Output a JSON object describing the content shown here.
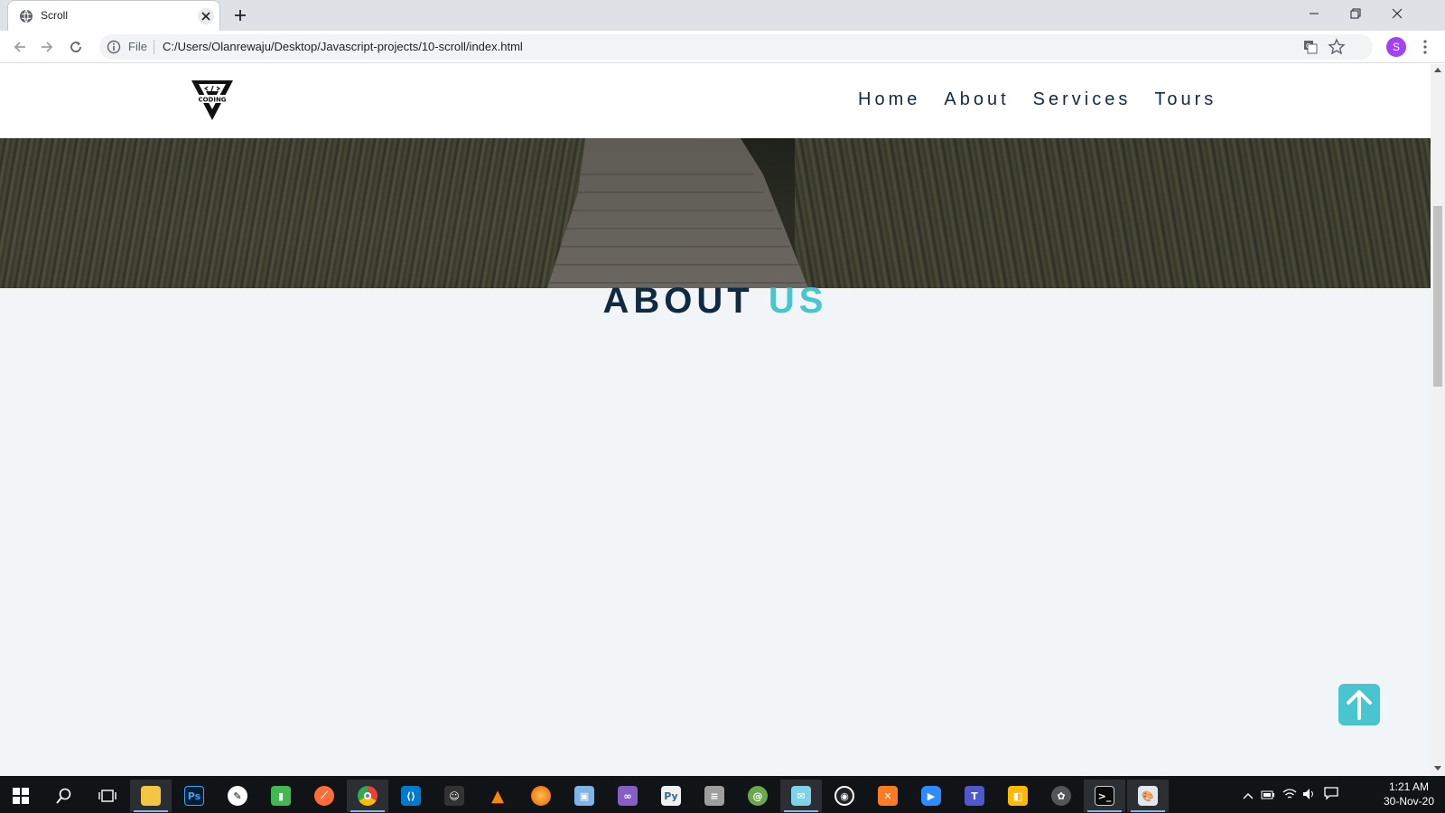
{
  "browser": {
    "tab_title": "Scroll",
    "url_scheme_label": "File",
    "url": "C:/Users/Olanrewaju/Desktop/Javascript-projects/10-scroll/index.html",
    "profile_initial": "S"
  },
  "page": {
    "logo_text": "CODING",
    "nav_links": [
      "Home",
      "About",
      "Services",
      "Tours"
    ],
    "about_title_main": "ABOUT",
    "about_title_accent": "US",
    "colors": {
      "primary": "#102a42",
      "accent": "#49c5d0",
      "background": "#f1f5f8"
    },
    "scroll_top_icon": "arrow-up-icon"
  },
  "taskbar": {
    "apps": [
      "start",
      "search",
      "task-view",
      "file-explorer",
      "photoshop",
      "inkscape",
      "sublime-merge",
      "postman",
      "chrome",
      "vscode",
      "inkscape-ghost",
      "vlc",
      "firefox",
      "virtualbox",
      "visual-studio",
      "python-idle",
      "database",
      "chameleon",
      "mail",
      "obs",
      "xampp",
      "zoom",
      "teams",
      "paint-3d",
      "davinci",
      "terminal",
      "paint"
    ],
    "time": "1:21 AM",
    "date": "30-Nov-20"
  }
}
